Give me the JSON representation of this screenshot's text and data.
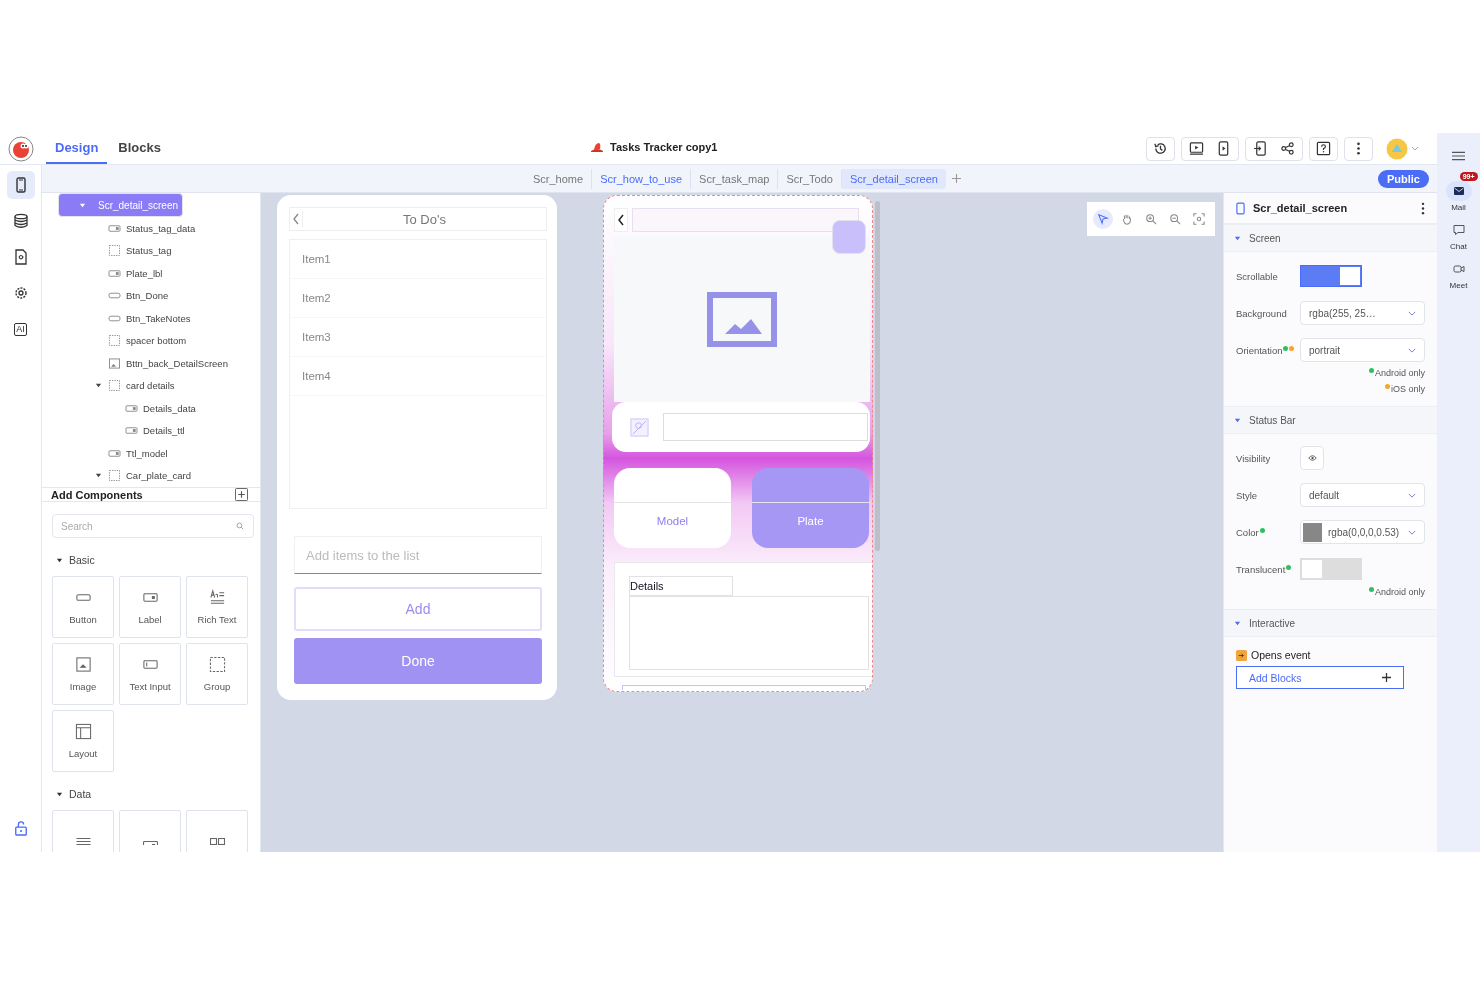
{
  "app": {
    "title": "Tasks Tracker copy1"
  },
  "mode_tabs": [
    {
      "label": "Design",
      "selected": true
    },
    {
      "label": "Blocks",
      "selected": false
    }
  ],
  "screen_tabs": [
    {
      "label": "Scr_home",
      "selected": false,
      "linked": false
    },
    {
      "label": "Scr_how_to_use",
      "selected": false,
      "linked": true
    },
    {
      "label": "Scr_task_map",
      "selected": false,
      "linked": false
    },
    {
      "label": "Scr_Todo",
      "selected": false,
      "linked": false
    },
    {
      "label": "Scr_detail_screen",
      "selected": true,
      "linked": false
    }
  ],
  "publish_button": "Public",
  "side_rail": [
    {
      "kind": "phone",
      "selected": true
    },
    {
      "kind": "database",
      "selected": false
    },
    {
      "kind": "file",
      "selected": false
    },
    {
      "kind": "gear",
      "selected": false
    },
    {
      "kind": "ai",
      "label": "AI",
      "selected": false
    }
  ],
  "layers": [
    {
      "label": "Scr_detail_screen",
      "kind": "screen",
      "selected": true,
      "expanded": true,
      "children": [
        {
          "label": "Status_tag_data",
          "kind": "label",
          "selected": false
        },
        {
          "label": "Status_tag",
          "kind": "group",
          "selected": false
        },
        {
          "label": "Plate_lbl",
          "kind": "label",
          "selected": false
        },
        {
          "label": "Btn_Done",
          "kind": "button",
          "selected": false
        },
        {
          "label": "Btn_TakeNotes",
          "kind": "button",
          "selected": false
        },
        {
          "label": "spacer bottom",
          "kind": "group",
          "selected": false
        },
        {
          "label": "Bttn_back_DetailScreen",
          "kind": "image",
          "selected": false
        },
        {
          "label": "card details",
          "kind": "group",
          "selected": false,
          "expanded": true,
          "children": [
            {
              "label": "Details_data",
              "kind": "label",
              "selected": false
            },
            {
              "label": "Details_ttl",
              "kind": "label",
              "selected": false
            }
          ]
        },
        {
          "label": "Ttl_model",
          "kind": "label",
          "selected": false
        },
        {
          "label": "Car_plate_card",
          "kind": "group",
          "selected": false,
          "expanded": true
        }
      ]
    }
  ],
  "add_components": {
    "title": "Add Components",
    "search_placeholder": "Search",
    "groups": [
      {
        "name": "Basic",
        "expanded": true,
        "items": [
          {
            "label": "Button",
            "kind": "button"
          },
          {
            "label": "Label",
            "kind": "label"
          },
          {
            "label": "Rich Text",
            "kind": "richtext"
          },
          {
            "label": "Image",
            "kind": "image"
          },
          {
            "label": "Text Input",
            "kind": "textinput"
          },
          {
            "label": "Group",
            "kind": "group"
          },
          {
            "label": "Layout",
            "kind": "layout"
          }
        ]
      },
      {
        "name": "Data",
        "expanded": true,
        "items": [
          {
            "kind": "list"
          },
          {
            "kind": "label"
          },
          {
            "kind": "grid"
          }
        ]
      }
    ]
  },
  "canvas_tools": [
    {
      "kind": "pointer",
      "selected": true
    },
    {
      "kind": "hand",
      "selected": false
    },
    {
      "kind": "zoom_in",
      "selected": false
    },
    {
      "kind": "zoom_out",
      "selected": false
    },
    {
      "kind": "fit",
      "selected": false
    }
  ],
  "todo_screen": {
    "title": "To Do's",
    "items": [
      "Item1",
      "Item2",
      "Item3",
      "Item4"
    ],
    "input_placeholder": "Add items to the list",
    "add_button": "Add",
    "done_button": "Done"
  },
  "detail_screen": {
    "model_label": "Model",
    "plate_label": "Plate",
    "details_title": "Details"
  },
  "properties": {
    "title": "Scr_detail_screen",
    "sections": [
      {
        "title": "Screen",
        "expanded": true,
        "rows": [
          {
            "kind": "toggle",
            "label": "Scrollable",
            "on": true
          },
          {
            "kind": "select",
            "label": "Background",
            "value": "rgba(255, 25…"
          },
          {
            "kind": "select",
            "label": "Orientation",
            "value": "portrait",
            "platforms": [
              {
                "color": "#2fbf62"
              },
              {
                "color": "#f5a623"
              }
            ]
          }
        ],
        "notes": [
          {
            "color": "#2fbf62",
            "text": "Android only"
          },
          {
            "color": "#f5a623",
            "text": "iOS only"
          }
        ]
      },
      {
        "title": "Status Bar",
        "expanded": true,
        "rows": [
          {
            "kind": "eye",
            "label": "Visibility",
            "on": true
          },
          {
            "kind": "select",
            "label": "Style",
            "value": "default"
          },
          {
            "kind": "swatch",
            "label": "Color",
            "value": "rgba(0,0,0,0.53)",
            "color": "#878787",
            "platforms": [
              {
                "color": "#2fbf62"
              }
            ]
          },
          {
            "kind": "toggle",
            "label": "Translucent",
            "on": false,
            "platforms": [
              {
                "color": "#2fbf62"
              }
            ]
          }
        ],
        "notes": [
          {
            "color": "#2fbf62",
            "text": "Android only"
          }
        ]
      },
      {
        "title": "Interactive",
        "expanded": true
      }
    ],
    "event": "Opens event",
    "add_blocks": "Add Blocks"
  },
  "right_rail": [
    {
      "label": "Mail",
      "badge": "99+",
      "selected": true
    },
    {
      "label": "Chat",
      "selected": false
    },
    {
      "label": "Meet",
      "selected": false
    }
  ]
}
